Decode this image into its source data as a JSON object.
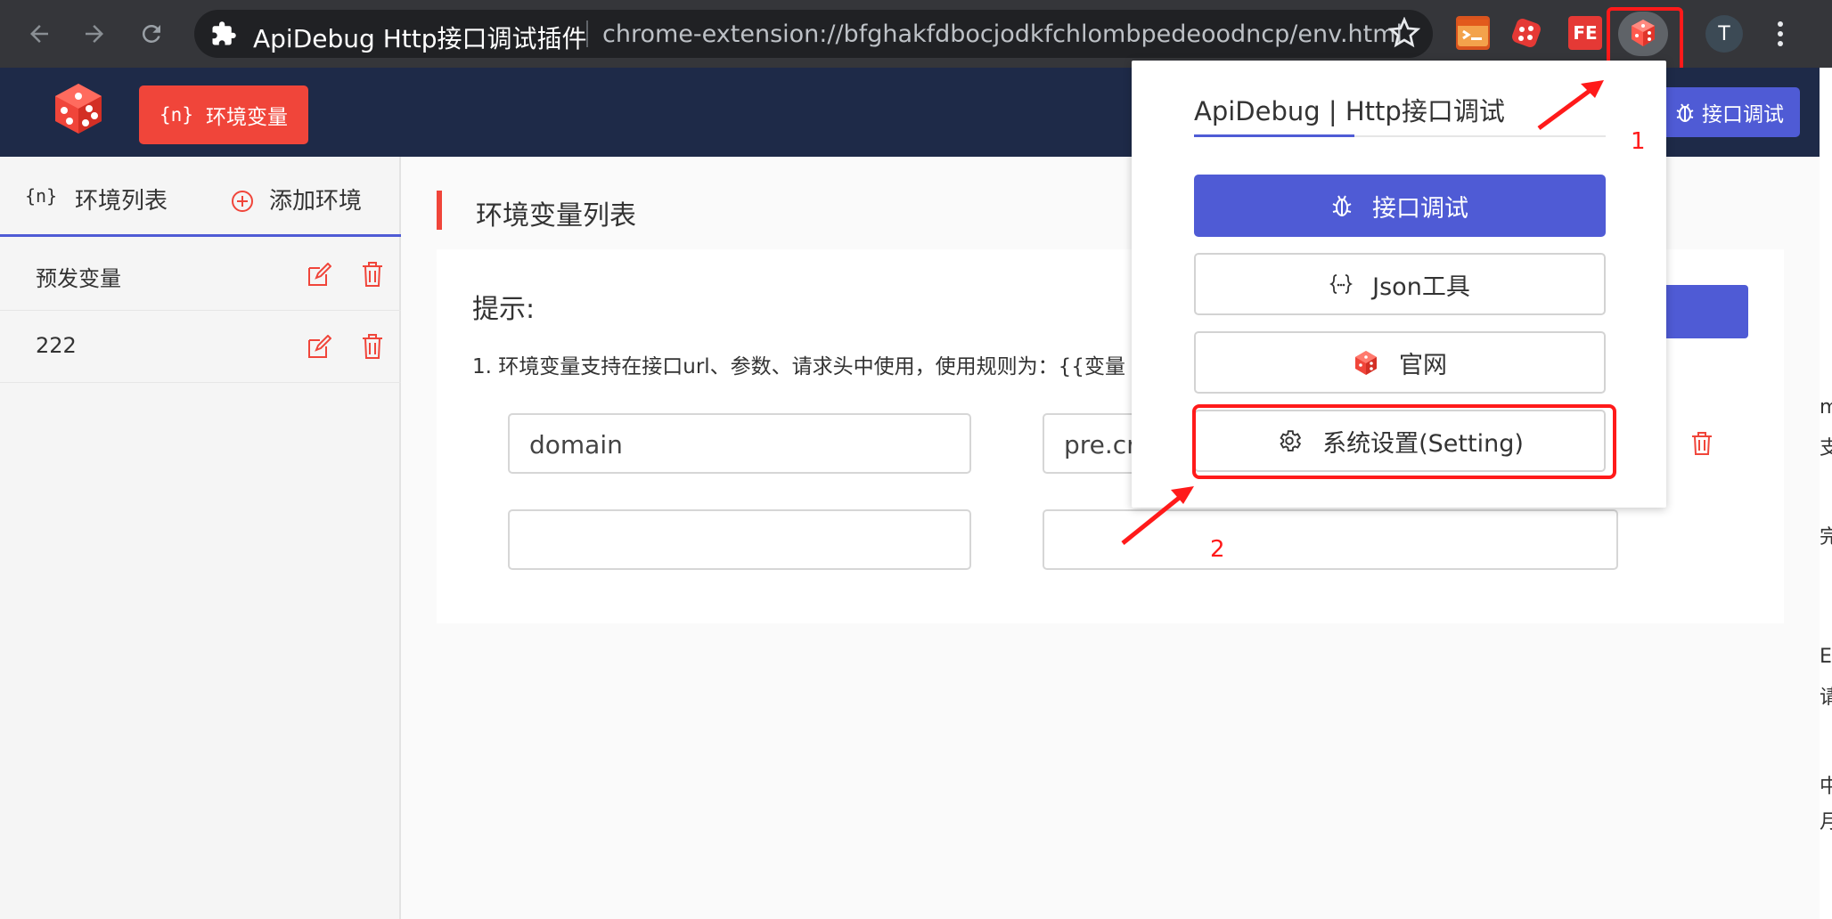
{
  "browser": {
    "tab_title": "ApiDebug Http接口调试插件",
    "url": "chrome-extension://bfghakfdbocjodkfchlombpedeoodncp/env.html",
    "ext_fe_label": "FE",
    "avatar_letter": "T"
  },
  "header": {
    "env_tab_icon": "{n}",
    "env_tab_label": "环境变量",
    "debug_button_label": "接口调试"
  },
  "sidebar": {
    "list_icon": "{n}",
    "list_label": "环境列表",
    "add_label": "添加环境",
    "items": [
      {
        "name": "预发变量"
      },
      {
        "name": "222"
      }
    ]
  },
  "main": {
    "title": "环境变量列表",
    "tip_title": "提示:",
    "tip_line1": "1. 环境变量支持在接口url、参数、请求头中使用，使用规则为：{{变量",
    "rows": [
      {
        "key": "domain",
        "value": "pre.cr"
      },
      {
        "key": "",
        "value": ""
      }
    ]
  },
  "popup": {
    "title": "ApiDebug | Http接口调试",
    "buttons": {
      "debug": "接口调试",
      "json": "Json工具",
      "site": "官网",
      "setting": "系统设置(Setting)"
    }
  },
  "annotations": {
    "step1": "1",
    "step2": "2",
    "color": "#ff1a1a"
  },
  "right_edge_fragments": [
    "m",
    "支",
    "完",
    "E",
    "请",
    "中",
    "月"
  ],
  "colors": {
    "accent": "#4f5bd5",
    "brand_red": "#f0453a",
    "header_bg": "#1e2a48",
    "chrome_bg": "#35363a"
  }
}
